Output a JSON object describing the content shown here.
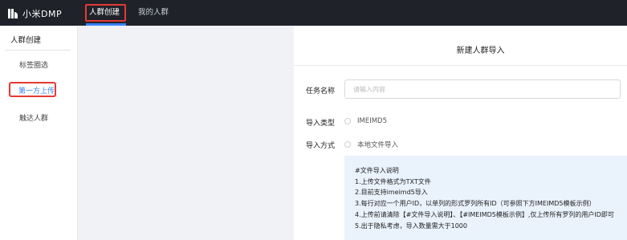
{
  "app": {
    "name": "小米DMP"
  },
  "nav": {
    "tabs": [
      {
        "label": "人群创建",
        "active": true
      },
      {
        "label": "我的人群",
        "active": false
      }
    ]
  },
  "sidebar": {
    "title": "人群创建",
    "items": [
      {
        "label": "标签圈选"
      },
      {
        "label": "第一方上传",
        "active": true
      },
      {
        "label": "触达人群"
      }
    ]
  },
  "panel": {
    "title": "新建人群导入",
    "task_name": {
      "label": "任务名称",
      "value": "",
      "placeholder": "请输入内容"
    },
    "import_type": {
      "label": "导入类型",
      "option": "IMEIMD5"
    },
    "import_method": {
      "label": "导入方式",
      "option": "本地文件导入"
    },
    "notice": {
      "lines": [
        "#文件导入说明",
        "1.上传文件格式为TXT文件",
        "2.目前支持imeimd5导入",
        "3.每行对应一个用户ID，以单列的形式罗列所有ID（可参照下方IMEIMD5模板示例）",
        "4.上传前请清除【#文件导入说明】、【#IMEIMD5模板示例】,仅上传所有罗列的用户ID即可",
        "5.出于隐私考虑，导入数量需大于1000"
      ]
    }
  },
  "colors": {
    "topbar": "#1f2329",
    "accent": "#3b82f6",
    "highlight": "#e53935",
    "notice_bg": "#eaf2fc"
  }
}
